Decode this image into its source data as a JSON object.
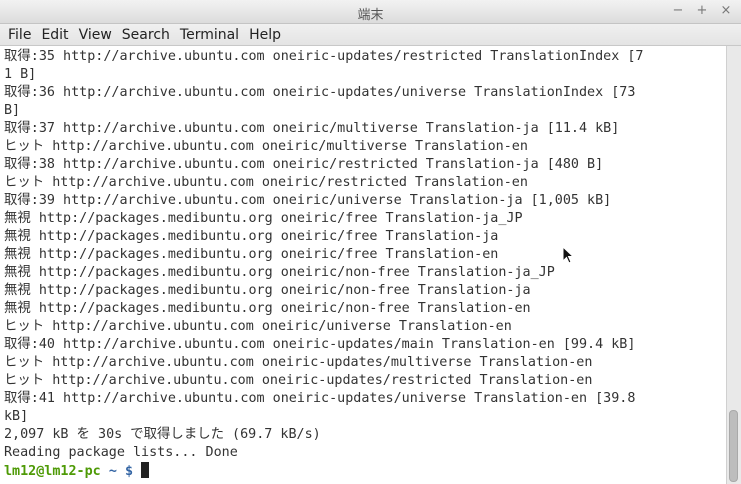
{
  "window": {
    "title": "端末",
    "controls": {
      "minimize": "−",
      "maximize": "+",
      "close": "×"
    }
  },
  "menu": [
    "File",
    "Edit",
    "View",
    "Search",
    "Terminal",
    "Help"
  ],
  "terminal": {
    "lines": [
      "取得:35 http://archive.ubuntu.com oneiric-updates/restricted TranslationIndex [7",
      "1 B]",
      "取得:36 http://archive.ubuntu.com oneiric-updates/universe TranslationIndex [73",
      "B]",
      "取得:37 http://archive.ubuntu.com oneiric/multiverse Translation-ja [11.4 kB]",
      "ヒット http://archive.ubuntu.com oneiric/multiverse Translation-en",
      "取得:38 http://archive.ubuntu.com oneiric/restricted Translation-ja [480 B]",
      "ヒット http://archive.ubuntu.com oneiric/restricted Translation-en",
      "取得:39 http://archive.ubuntu.com oneiric/universe Translation-ja [1,005 kB]",
      "無視 http://packages.medibuntu.org oneiric/free Translation-ja_JP",
      "無視 http://packages.medibuntu.org oneiric/free Translation-ja",
      "無視 http://packages.medibuntu.org oneiric/free Translation-en",
      "無視 http://packages.medibuntu.org oneiric/non-free Translation-ja_JP",
      "無視 http://packages.medibuntu.org oneiric/non-free Translation-ja",
      "無視 http://packages.medibuntu.org oneiric/non-free Translation-en",
      "ヒット http://archive.ubuntu.com oneiric/universe Translation-en",
      "取得:40 http://archive.ubuntu.com oneiric-updates/main Translation-en [99.4 kB]",
      "ヒット http://archive.ubuntu.com oneiric-updates/multiverse Translation-en",
      "ヒット http://archive.ubuntu.com oneiric-updates/restricted Translation-en",
      "取得:41 http://archive.ubuntu.com oneiric-updates/universe Translation-en [39.8",
      "kB]",
      "2,097 kB を 30s で取得しました (69.7 kB/s)",
      "Reading package lists... Done"
    ],
    "prompt": {
      "user_host": "lm12@lm12-pc",
      "path": "~",
      "symbol": "$"
    }
  },
  "colors": {
    "prompt_user": "#4e9a06",
    "prompt_path": "#3465a4",
    "text": "#333333",
    "background": "#ffffff"
  }
}
